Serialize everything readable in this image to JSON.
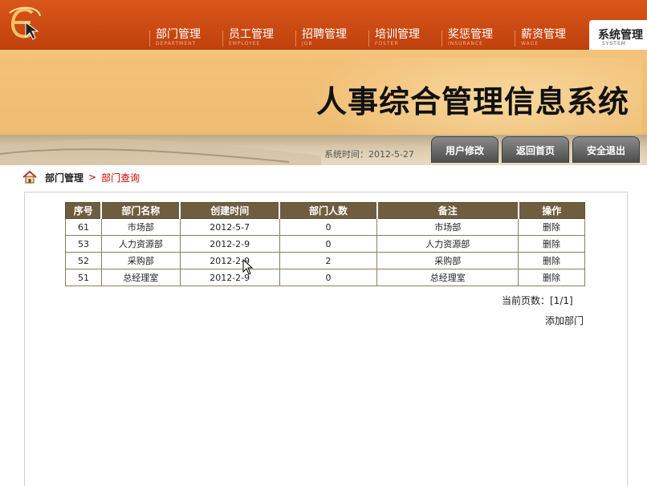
{
  "nav": {
    "items": [
      {
        "label": "部门管理",
        "sub": "DEPARTMENT"
      },
      {
        "label": "员工管理",
        "sub": "EMPLOYEE"
      },
      {
        "label": "招聘管理",
        "sub": "JOB"
      },
      {
        "label": "培训管理",
        "sub": "FOSTER"
      },
      {
        "label": "奖惩管理",
        "sub": "INSURANCE"
      },
      {
        "label": "薪资管理",
        "sub": "WAGE"
      }
    ],
    "active": {
      "label": "系统管理",
      "sub": "SYSTEM"
    }
  },
  "banner": {
    "title": "人事综合管理信息系统",
    "system_time": "系统时间：2012-5-27",
    "buttons": {
      "user_modify": "用户修改",
      "back_home": "返回首页",
      "logout": "安全退出"
    }
  },
  "breadcrumb": {
    "parent": "部门管理",
    "separator": ">",
    "current": "部门查询"
  },
  "table": {
    "headers": {
      "id": "序号",
      "name": "部门名称",
      "created": "创建时间",
      "count": "部门人数",
      "remark": "备注",
      "op": "操作"
    },
    "rows": [
      {
        "id": "61",
        "name": "市场部",
        "created": "2012-5-7",
        "count": "0",
        "remark": "市场部",
        "op": "删除"
      },
      {
        "id": "53",
        "name": "人力资源部",
        "created": "2012-2-9",
        "count": "0",
        "remark": "人力资源部",
        "op": "删除"
      },
      {
        "id": "52",
        "name": "采购部",
        "created": "2012-2-9",
        "count": "2",
        "remark": "采购部",
        "op": "删除"
      },
      {
        "id": "51",
        "name": "总经理室",
        "created": "2012-2-9",
        "count": "0",
        "remark": "总经理室",
        "op": "删除"
      }
    ]
  },
  "pager": {
    "text": "当前页数：[1/1]"
  },
  "actions": {
    "add": "添加部门"
  },
  "colors": {
    "nav_orange": "#c9480f",
    "banner": "#f0be76",
    "header_brown": "#6f5d40",
    "accent_red": "#cc0000"
  }
}
